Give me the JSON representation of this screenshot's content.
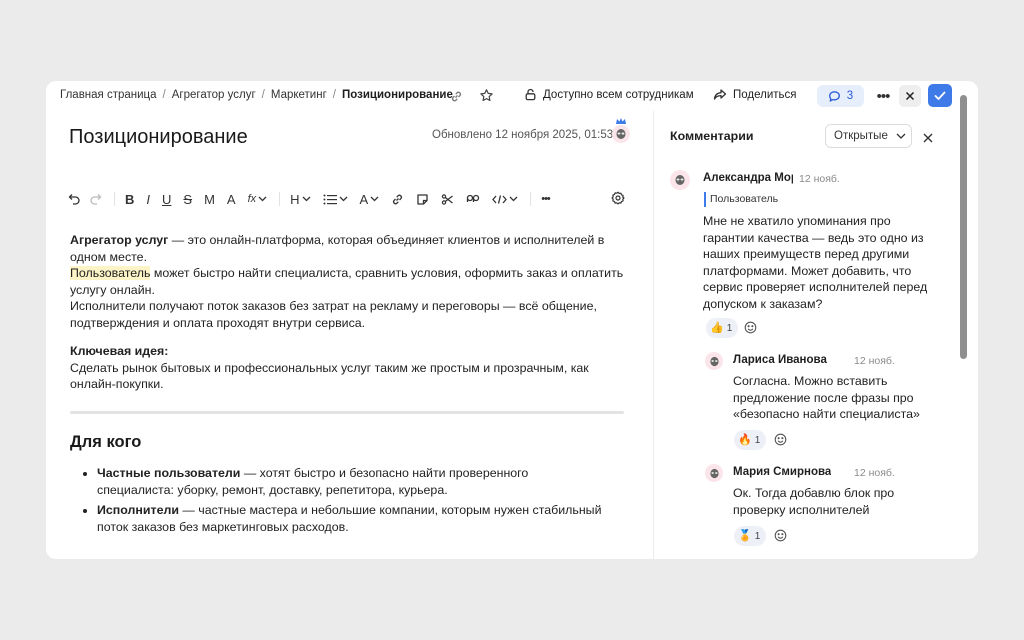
{
  "breadcrumbs": {
    "home": "Главная страница",
    "aggregator": "Агрегатор услуг",
    "marketing": "Маркетинг",
    "current": "Позиционирование",
    "separator": "/"
  },
  "header": {
    "access_label": "Доступно всем сотрудникам",
    "share_label": "Поделиться",
    "comments_count": "3",
    "more_label": "•••"
  },
  "document": {
    "title": "Позиционирование",
    "updated": "Обновлено 12 ноября 2025, 01:53",
    "p1_bold": "Агрегатор услуг",
    "p1_rest": " — это онлайн-платформа, которая объединяет клиентов и исполнителей в одном месте.",
    "p2_highlight": "Пользователь",
    "p2_rest": " может быстро найти специалиста, сравнить условия, оформить заказ и оплатить услугу онлайн.",
    "p3": "Исполнители получают поток заказов без затрат на рекламу и переговоры — всё общение, подтверждения и оплата проходят внутри сервиса.",
    "key_idea_label": "Ключевая идея:",
    "key_idea_text": "Сделать рынок бытовых и профессиональных услуг таким же простым и прозрачным, как онлайн-покупки.",
    "section_title": "Для кого",
    "bullets": [
      {
        "bold": "Частные пользователи",
        "rest": " — хотят быстро и безопасно найти проверенного специалиста: уборку, ремонт, доставку, репетитора, курьера."
      },
      {
        "bold": "Исполнители",
        "rest": " — частные мастера и небольшие компании, которым нужен стабильный поток заказов без маркетинговых расходов."
      }
    ]
  },
  "toolbar": {
    "bold": "B",
    "italic": "I",
    "underline": "U",
    "strike": "S",
    "monospace": "M",
    "text_size": "A",
    "formula": "fx",
    "heading": "H",
    "color": "A",
    "more": "•••"
  },
  "comments_panel": {
    "title": "Комментарии",
    "filter_value": "Открытые",
    "comments": [
      {
        "author": "Александра Мор",
        "date": "12 нояб.",
        "quote": "Пользователь",
        "text_lines": [
          "Мне не хватило упоминания про",
          "гарантии качества — ведь это одно из",
          "наших преимуществ перед другими",
          "платформами. Может добавить, что",
          "сервис проверяет исполнителей перед",
          "допуском к заказам?"
        ],
        "reaction_emoji": "👍",
        "reaction_count": "1"
      },
      {
        "author": "Лариса Иванова",
        "date": "12 нояб.",
        "text_lines": [
          "Согласна. Можно вставить",
          "предложение после фразы про",
          "«безопасно найти специалиста»"
        ],
        "reaction_emoji": "🔥",
        "reaction_count": "1"
      },
      {
        "author": "Мария Смирнова",
        "date": "12 нояб.",
        "text_lines": [
          "Ок. Тогда добавлю блок про",
          "проверку исполнителей"
        ],
        "reaction_emoji": "🏅",
        "reaction_count": "1"
      }
    ]
  },
  "colors": {
    "accent": "#3e7ae8",
    "highlight": "#fcf3c6",
    "avatar_bg": "#fbe4ea",
    "reaction_bg": "#eef0f7"
  }
}
